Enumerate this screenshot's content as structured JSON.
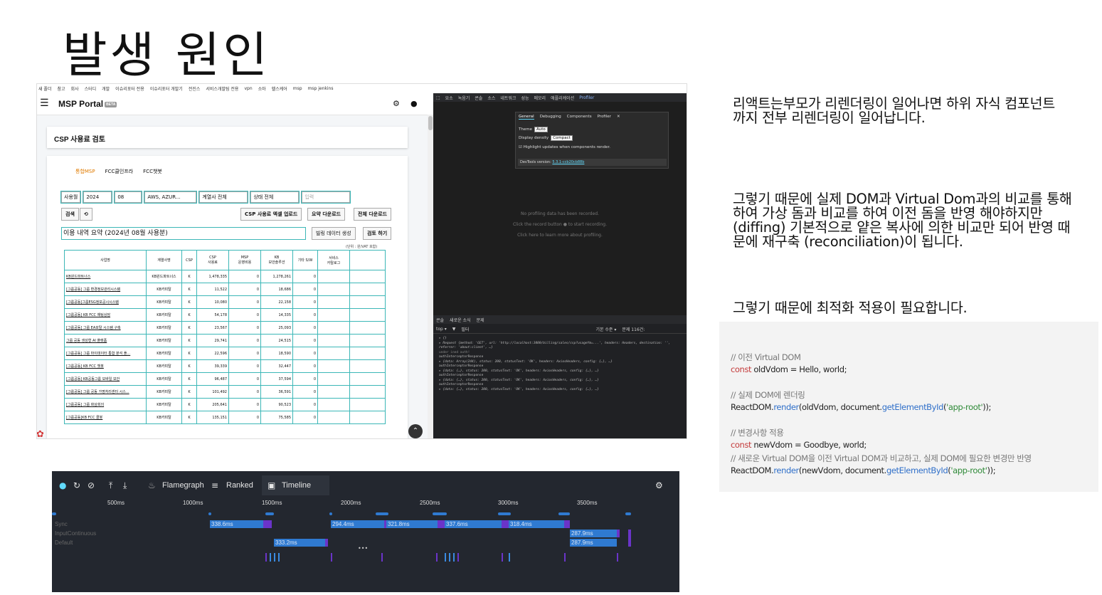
{
  "slide": {
    "title": "발생 원인"
  },
  "bookmarks": [
    "새 폴더",
    "참고",
    "회사",
    "스터디",
    "개발",
    "이슈리포터 전용",
    "이슈리포터 개발기",
    "전진스",
    "서비스개발팀 전용",
    "vpn",
    "소마",
    "헬스케어",
    "msp",
    "msp jenkins"
  ],
  "app": {
    "brand": "MSP Portal",
    "beta": "BETA",
    "page_title": "CSP 사용료 검토",
    "tabs": [
      "통합MSP",
      "FCC클인프라",
      "FCC챗봇"
    ],
    "filters": {
      "type": "사용월",
      "year": "2024",
      "month": "08",
      "csp": "AWS, AZUR...",
      "account": "계열사 전체",
      "status": "상태 전체",
      "search_placeholder": "입력"
    },
    "buttons": {
      "search": "검색",
      "refresh": "⟲",
      "excel_upload": "CSP 사용료 엑셀 업로드",
      "summary_download": "요약 다운로드",
      "all_download": "전체 다운로드",
      "billing_create": "빌링 데이터 생성",
      "review": "검토 하기"
    },
    "summary_label": "이용 내역 요약 (2024년 08월 사용분)",
    "unit": "(단위 : 원/VAT 포함)",
    "columns": [
      "사업명",
      "계열사명",
      "CSP",
      "CSP\n사용료",
      "MSP\n운영비용",
      "KB\n보안솔루션",
      "기타 S/W",
      "서비스\n카탈로그"
    ],
    "rows": [
      [
        "KB원드파트너스",
        "KB원드파트너스",
        "K",
        "1,478,335",
        "0",
        "1,278,261",
        "0"
      ],
      [
        "[그룹공동] 그룹 환경정보관리시스템",
        "KB카피탈",
        "K",
        "11,522",
        "0",
        "18,686",
        "0"
      ],
      [
        "[그룹공동]그룹ESG정보공시시스템",
        "KB카피탈",
        "K",
        "10,080",
        "0",
        "22,158",
        "0"
      ],
      [
        "[그룹공동] KB FCC 채팅상담",
        "KB카피탈",
        "K",
        "54,178",
        "0",
        "14,335",
        "0"
      ],
      [
        "[그룹공동] 그룹 EA포탈 시스템 구축",
        "KB카피탈",
        "K",
        "23,567",
        "0",
        "25,093",
        "0"
      ],
      [
        "그룹 공동 생성형 AI 플랫폼",
        "KB카피탈",
        "K",
        "29,741",
        "0",
        "24,515",
        "0"
      ],
      [
        "[그룹공동] 그룹 마이데이터 통합 분석 플...",
        "KB카피탈",
        "K",
        "22,596",
        "0",
        "18,590",
        "0"
      ],
      [
        "[그룹공동] KB FCC 챗봇",
        "KB카피탈",
        "K",
        "39,339",
        "0",
        "32,447",
        "0"
      ],
      [
        "[그룹공동] KB공동그룹 모바일 보안",
        "KB카피탈",
        "K",
        "96,487",
        "0",
        "37,594",
        "0"
      ],
      [
        "[그룹공동] 그룹 공동 가명처리센터 시스...",
        "KB카피탈",
        "K",
        "101,492",
        "0",
        "36,591",
        "0"
      ],
      [
        "[그룹공동] 그룹 화상회의",
        "KB카피탈",
        "K",
        "205,641",
        "0",
        "90,523",
        "0"
      ],
      [
        "[그룹공동]KB FCC 콜봇",
        "KB카피탈",
        "K",
        "135,151",
        "0",
        "75,585",
        "0"
      ]
    ]
  },
  "devtools": {
    "tabs": [
      "요소",
      "녹음기",
      "콘솔",
      "소스",
      "네트워크",
      "성능",
      "메모리",
      "애플리케이션",
      "Profiler"
    ],
    "settings_tabs": [
      "General",
      "Debugging",
      "Components",
      "Profiler"
    ],
    "theme_label": "Theme",
    "theme_value": "Auto",
    "density_label": "Display density",
    "density_value": "Compact",
    "highlight_label": "Highlight updates when components render.",
    "version_label": "DevTools version:",
    "version_value": "5.3.1-ccb20cb88b",
    "no_profiling": "No profiling data has been recorded.",
    "record_hint": "Click the record button ● to start recording.",
    "learn_more": "Click here to learn more about profiling.",
    "console_tabs": [
      "콘솔",
      "새로운 소식",
      "문제"
    ],
    "console_top": "top ▾",
    "console_filter": "필터",
    "console_level": "기본 수준 ▾",
    "console_issues": "문제 116건:",
    "log": [
      "▸ {}",
      "▸ Request {method: 'GET', url: 'http://localhost:3000/billing/sales/csp?usageYm=...', headers: Headers, destination: '', referrer: 'about:client', …}",
      "under ined   auth!",
      "authInterceptorResponse",
      "▸ {data: Array(244), status: 200, statusText: 'OK', headers: AxiosHeaders, config: {…}, …}",
      "authInterceptorResponse",
      "▸ {data: {…}, status: 200, statusText: 'OK', headers: AxiosHeaders, config: {…}, …}",
      "authInterceptorResponse",
      "▸ {data: {…}, status: 200, statusText: 'OK', headers: AxiosHeaders, config: {…}, …}",
      "authInterceptorResponse",
      "▸ {data: {…}, status: 200, statusText: 'OK', headers: AxiosHeaders, config: {…}, …}"
    ]
  },
  "profiler": {
    "toolbar": {
      "flamegraph": "Flamegraph",
      "ranked": "Ranked",
      "timeline": "Timeline"
    },
    "ticks": [
      "500ms",
      "1000ms",
      "1500ms",
      "2000ms",
      "2500ms",
      "3000ms",
      "3500ms"
    ],
    "lanes": [
      "Sync",
      "InputContinuous",
      "Default"
    ],
    "sync_bars": [
      "338.6ms",
      "294.4ms",
      "321.8ms",
      "337.6ms",
      "318.4ms",
      "287.9ms"
    ],
    "input_bars": [],
    "default_bars": [
      "333.2ms",
      "287.9ms"
    ],
    "ellipsis": "•••"
  },
  "text": {
    "p1": "리액트는부모가 리렌더링이 일어나면 하위 자식 컴포넌트까지 전부 리렌더링이 일어납니다.",
    "p2": "그렇기 때문에 실제 DOM과 Virtual Dom과의 비교를 통해하여 가상 돔과 비교를 하여 이전 돔을 반영 해야하지만(diffing) 기본적으로 얕은 복사에 의한 비교만 되어 반영 때문에 재구축 (reconciliation)이 됩니다.",
    "p3": "그렇기 때문에 최적화 적용이 필요합니다."
  },
  "code": {
    "c1": "// 이전 Virtual DOM",
    "l1_kw": "const",
    "l1": " oldVdom = Hello, world;",
    "c2": "// 실제 DOM에 렌더링",
    "l2a": "ReactDOM.",
    "l2fn": "render",
    "l2b": "(oldVdom, document.",
    "l2fn2": "getElementById",
    "l2c": "(",
    "l2str": "'app-root'",
    "l2d": "));",
    "c3": "// 변경사항 적용",
    "l3_kw": "const",
    "l3": " newVdom = Goodbye, world;",
    "c4": "// 새로운 Virtual DOM을 이전 Virtual DOM과 비교하고, 실제 DOM에 필요한 변경만 반영",
    "l4a": "ReactDOM.",
    "l4fn": "render",
    "l4b": "(newVdom, document.",
    "l4fn2": "getElementById",
    "l4c": "(",
    "l4str": "'app-root'",
    "l4d": "));"
  },
  "colors": {
    "accent_orange": "#e07b00",
    "grid_teal": "#3cb7b7",
    "profiler_blue": "#2f7ad1",
    "profiler_purple": "#6a34c9"
  }
}
